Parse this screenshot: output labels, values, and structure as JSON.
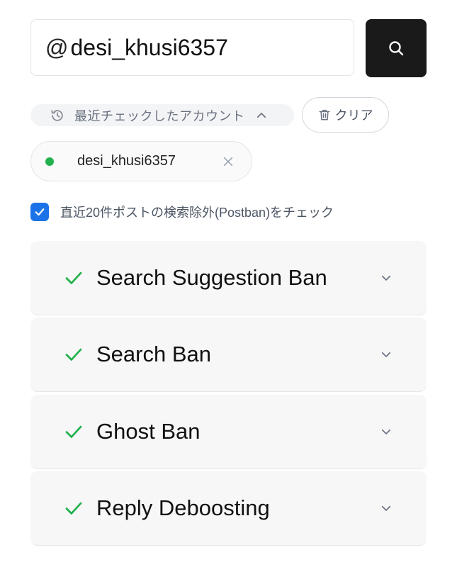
{
  "search": {
    "prefix": "@",
    "value": "desi_khusi6357"
  },
  "history": {
    "label": "最近チェックしたアカウント",
    "clear_label": "クリア",
    "items": [
      {
        "name": "desi_khusi6357",
        "status_color": "#22b14c"
      }
    ]
  },
  "option": {
    "checked": true,
    "label": "直近20件ポストの検索除外(Postban)をチェック"
  },
  "results": [
    {
      "title": "Search Suggestion Ban",
      "status": "pass"
    },
    {
      "title": "Search Ban",
      "status": "pass"
    },
    {
      "title": "Ghost Ban",
      "status": "pass"
    },
    {
      "title": "Reply Deboosting",
      "status": "pass"
    }
  ],
  "colors": {
    "accent": "#1c73e8",
    "success": "#22b14c",
    "button_dark": "#1a1a1a"
  }
}
